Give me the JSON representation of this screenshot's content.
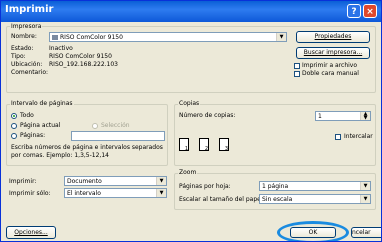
{
  "window": {
    "title": "Imprimir",
    "help": "?",
    "close": "×"
  },
  "printer": {
    "group": "Impresora",
    "name_label": "Nombre:",
    "name_value": "RISO ComColor 9150",
    "properties": "Propiedades",
    "status_label": "Estado:",
    "status_value": "Inactivo",
    "type_label": "Tipo:",
    "type_value": "RISO ComColor 9150",
    "location_label": "Ubicación:",
    "location_value": "RISO_192.168.222.103",
    "comment_label": "Comentario:",
    "find_printer": "Buscar impresora...",
    "print_to_file": "Imprimir a archivo",
    "duplex": "Doble cara manual"
  },
  "range": {
    "group": "Intervalo de páginas",
    "all": "Todo",
    "current": "Página actual",
    "selection": "Selección",
    "pages": "Páginas:",
    "hint1": "Escriba números de página e intervalos separados",
    "hint2": "por comas. Ejemplo: 1,3,5-12,14"
  },
  "copies": {
    "group": "Copias",
    "label": "Número de copias:",
    "value": "1",
    "collate": "Intercalar",
    "page_nums": [
      "1",
      "2",
      "3"
    ]
  },
  "print_what": {
    "label": "Imprimir:",
    "value": "Documento"
  },
  "print_only": {
    "label": "Imprimir sólo:",
    "value": "El intervalo"
  },
  "zoom": {
    "group": "Zoom",
    "pages_label": "Páginas por hoja:",
    "pages_value": "1 página",
    "scale_label": "Escalar al tamaño del papel:",
    "scale_value": "Sin escala"
  },
  "buttons": {
    "options": "Opciones...",
    "ok": "OK",
    "cancel": "ncelar"
  },
  "colors": {
    "highlight": "#1a8be0"
  }
}
